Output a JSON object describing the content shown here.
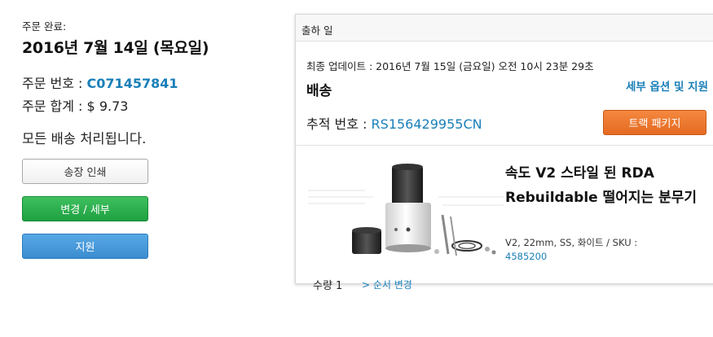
{
  "order": {
    "date_label": "주문 완료:",
    "date": "2016년 7월 14일 (목요일)",
    "number_label": "주문 번호 :",
    "number": "C071457841",
    "total_label": "주문 합계 :",
    "total": "$ 9.73",
    "status": "모든 배송 처리됩니다."
  },
  "actions": {
    "print_invoice": "송장 인쇄",
    "change_details": "변경 / 세부",
    "support": "지원"
  },
  "shipment": {
    "header": "출하 일",
    "updated": "최종 업데이트 : 2016년 7월 15일 (금요일) 오전 10시 23분 29초",
    "delivery_title": "배송",
    "details_link": "세부 옵션 및 지원",
    "tracking_label": "추적 번호 :",
    "tracking_number": "RS156429955CN",
    "track_button": "트랙 패키지"
  },
  "product": {
    "title": "속도 V2 스타일 된 RDA Rebuildable 떨어지는 분무기",
    "description": "V2, 22mm, SS, 화이트 / SKU :",
    "sku": "4585200",
    "quantity": "수량 1",
    "change_order_link": "> 순서 변경"
  },
  "colors": {
    "link": "#1a7fb8",
    "green_button": "#1fa042",
    "blue_button": "#3a8dd0",
    "orange_button": "#e46a22"
  }
}
